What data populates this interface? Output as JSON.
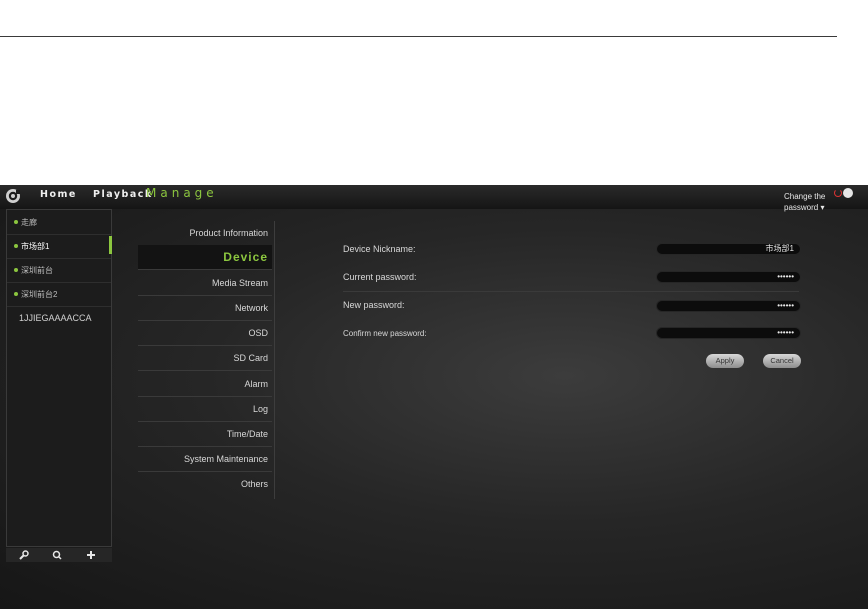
{
  "nav": {
    "home": "Home",
    "playback": "Playback",
    "manage": "Manage"
  },
  "header": {
    "change_password": "Change the",
    "change_password_2": "password ▾"
  },
  "sidebar": {
    "items": [
      {
        "label": "走廊"
      },
      {
        "label": "市场部1"
      },
      {
        "label": "深圳前台"
      },
      {
        "label": "深圳前台2"
      },
      {
        "label": "1JJIEGAAAACCA"
      }
    ],
    "tools": [
      "wrench-icon",
      "search-icon",
      "plus-icon"
    ]
  },
  "menu": {
    "items": [
      "Product Information",
      "Device",
      "Media Stream",
      "Network",
      "OSD",
      "SD Card",
      "Alarm",
      "Log",
      "Time/Date",
      "System Maintenance",
      "Others"
    ],
    "active": "Device"
  },
  "form": {
    "nickname_label": "Device Nickname:",
    "nickname_value": "市场部1",
    "current_label": "Current password:",
    "current_value": "••••••",
    "new_label": "New password:",
    "new_value": "••••••",
    "confirm_label": "Confirm new password:",
    "confirm_value": "••••••",
    "apply": "Apply",
    "cancel": "Cancel"
  },
  "colors": {
    "accent": "#8cc63f",
    "background": "#262626"
  }
}
